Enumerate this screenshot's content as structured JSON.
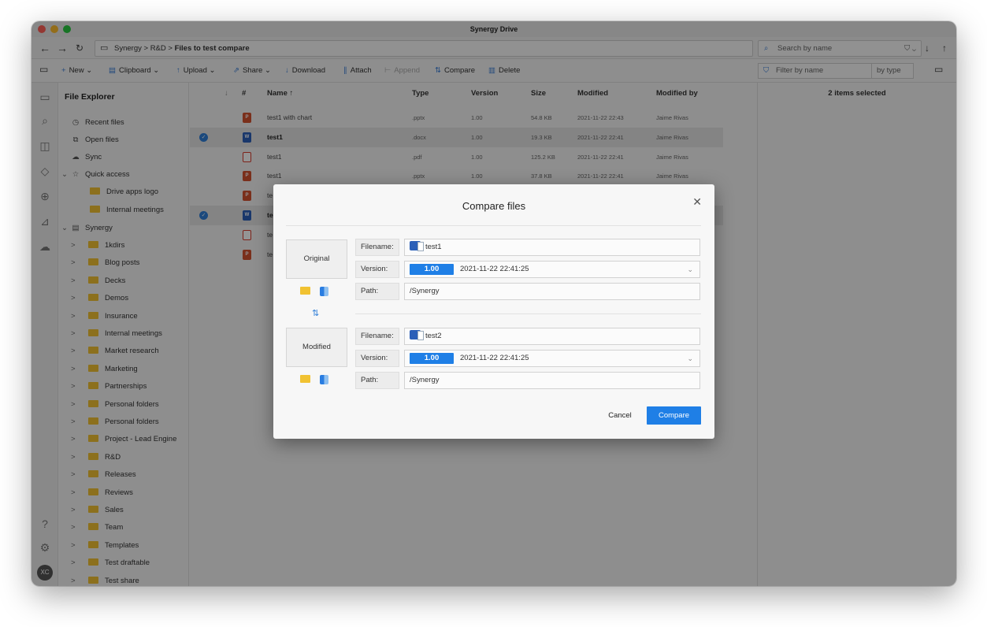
{
  "window": {
    "title": "Synergy Drive"
  },
  "nav": {
    "breadcrumb": [
      "Synergy",
      "R&D",
      "Files to test compare"
    ],
    "search_placeholder": "Search by name"
  },
  "toolbar": {
    "new": "New",
    "clipboard": "Clipboard",
    "upload": "Upload",
    "share": "Share",
    "download": "Download",
    "attach": "Attach",
    "append": "Append",
    "compare": "Compare",
    "delete": "Delete",
    "filter_placeholder": "Filter by name",
    "type_filter": "by type"
  },
  "sidebar": {
    "title": "File Explorer",
    "top_items": [
      "Recent files",
      "Open files",
      "Sync"
    ],
    "quick_access": {
      "label": "Quick access",
      "items": [
        "Drive apps logo",
        "Internal meetings"
      ]
    },
    "root": {
      "label": "Synergy",
      "folders": [
        "1kdirs",
        "Blog posts",
        "Decks",
        "Demos",
        "Insurance",
        "Internal meetings",
        "Market research",
        "Marketing",
        "Partnerships",
        "Personal folders",
        "Personal folders",
        "Project - Lead Engine",
        "R&D",
        "Releases",
        "Reviews",
        "Sales",
        "Team",
        "Templates",
        "Test draftable",
        "Test share"
      ]
    },
    "avatar": "XC"
  },
  "filelist": {
    "columns": {
      "index": "#",
      "name": "Name ↑",
      "type": "Type",
      "version": "Version",
      "size": "Size",
      "modified": "Modified",
      "modified_by": "Modified by"
    },
    "rows": [
      {
        "name": "test1 with chart",
        "type": ".pptx",
        "version": "1.00",
        "size": "54.8 KB",
        "modified": "2021-11-22 22:43",
        "modified_by": "Jaime Rivas",
        "icon": "pptx",
        "selected": false
      },
      {
        "name": "test1",
        "type": ".docx",
        "version": "1.00",
        "size": "19.3 KB",
        "modified": "2021-11-22 22:41",
        "modified_by": "Jaime Rivas",
        "icon": "docx",
        "selected": true
      },
      {
        "name": "test1",
        "type": ".pdf",
        "version": "1.00",
        "size": "125.2 KB",
        "modified": "2021-11-22 22:41",
        "modified_by": "Jaime Rivas",
        "icon": "pdf",
        "selected": false
      },
      {
        "name": "test1",
        "type": ".pptx",
        "version": "1.00",
        "size": "37.8 KB",
        "modified": "2021-11-22 22:41",
        "modified_by": "Jaime Rivas",
        "icon": "pptx",
        "selected": false
      },
      {
        "name": "te",
        "type": "",
        "version": "",
        "size": "",
        "modified": "",
        "modified_by": "",
        "icon": "pptx",
        "selected": false
      },
      {
        "name": "te",
        "type": "",
        "version": "",
        "size": "",
        "modified": "",
        "modified_by": "",
        "icon": "docx",
        "selected": true
      },
      {
        "name": "te",
        "type": "",
        "version": "",
        "size": "",
        "modified": "",
        "modified_by": "",
        "icon": "pdf",
        "selected": false
      },
      {
        "name": "te",
        "type": "",
        "version": "",
        "size": "",
        "modified": "",
        "modified_by": "",
        "icon": "pptx",
        "selected": false
      }
    ]
  },
  "details": {
    "title": "2 items selected"
  },
  "dialog": {
    "title": "Compare files",
    "original": {
      "label": "Original",
      "filename_label": "Filename:",
      "filename": "test1",
      "version_label": "Version:",
      "version": "1.00",
      "version_date": "2021-11-22 22:41:25",
      "path_label": "Path:",
      "path": "/Synergy"
    },
    "modified": {
      "label": "Modified",
      "filename_label": "Filename:",
      "filename": "test2",
      "version_label": "Version:",
      "version": "1.00",
      "version_date": "2021-11-22 22:41:25",
      "path_label": "Path:",
      "path": "/Synergy"
    },
    "cancel": "Cancel",
    "compare": "Compare"
  }
}
